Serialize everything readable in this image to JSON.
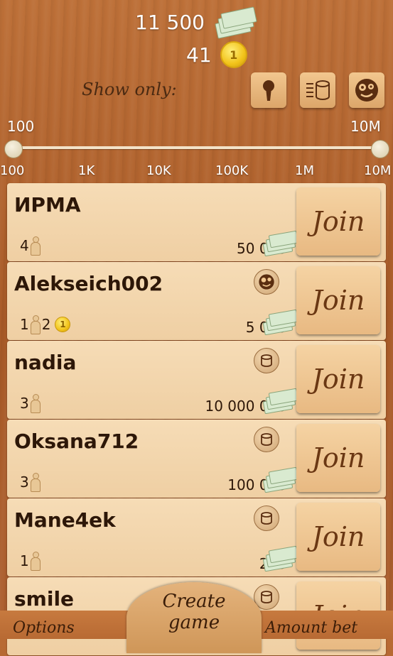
{
  "header": {
    "money": "11 500",
    "coins": "41",
    "coin_icon_text": "1",
    "show_only_label": "Show only:",
    "filters": [
      {
        "icon": "keyhole-icon"
      },
      {
        "icon": "coin-stack-icon"
      },
      {
        "icon": "crazy-face-icon"
      }
    ]
  },
  "slider": {
    "min_label": "100",
    "max_label": "10M",
    "ticks": [
      "100",
      "1K",
      "10K",
      "100K",
      "1M",
      "10M"
    ],
    "selected_min_fraction": 0.0,
    "selected_max_fraction": 1.0
  },
  "games": [
    {
      "name": "ИРМА",
      "players": "4",
      "coin_players": "",
      "bet": "50 000",
      "type_icon": ""
    },
    {
      "name": "Alekseich002",
      "players": "1",
      "coin_players": "2",
      "bet": "5 000",
      "type_icon": "crazy-face-icon"
    },
    {
      "name": "nadia",
      "players": "3",
      "coin_players": "",
      "bet": "10 000 000",
      "type_icon": "coin-stack-icon"
    },
    {
      "name": "Oksana712",
      "players": "3",
      "coin_players": "",
      "bet": "100 000",
      "type_icon": "coin-stack-icon"
    },
    {
      "name": "Mane4ek",
      "players": "1",
      "coin_players": "",
      "bet": "250",
      "type_icon": "coin-stack-icon"
    },
    {
      "name": "smile",
      "players": "",
      "coin_players": "",
      "bet": "",
      "type_icon": "coin-stack-icon"
    }
  ],
  "join_label": "Join",
  "bottom": {
    "options_label": "Options",
    "create_label_1": "Create",
    "create_label_2": "game",
    "amount_bet_label": "Amount bet"
  }
}
